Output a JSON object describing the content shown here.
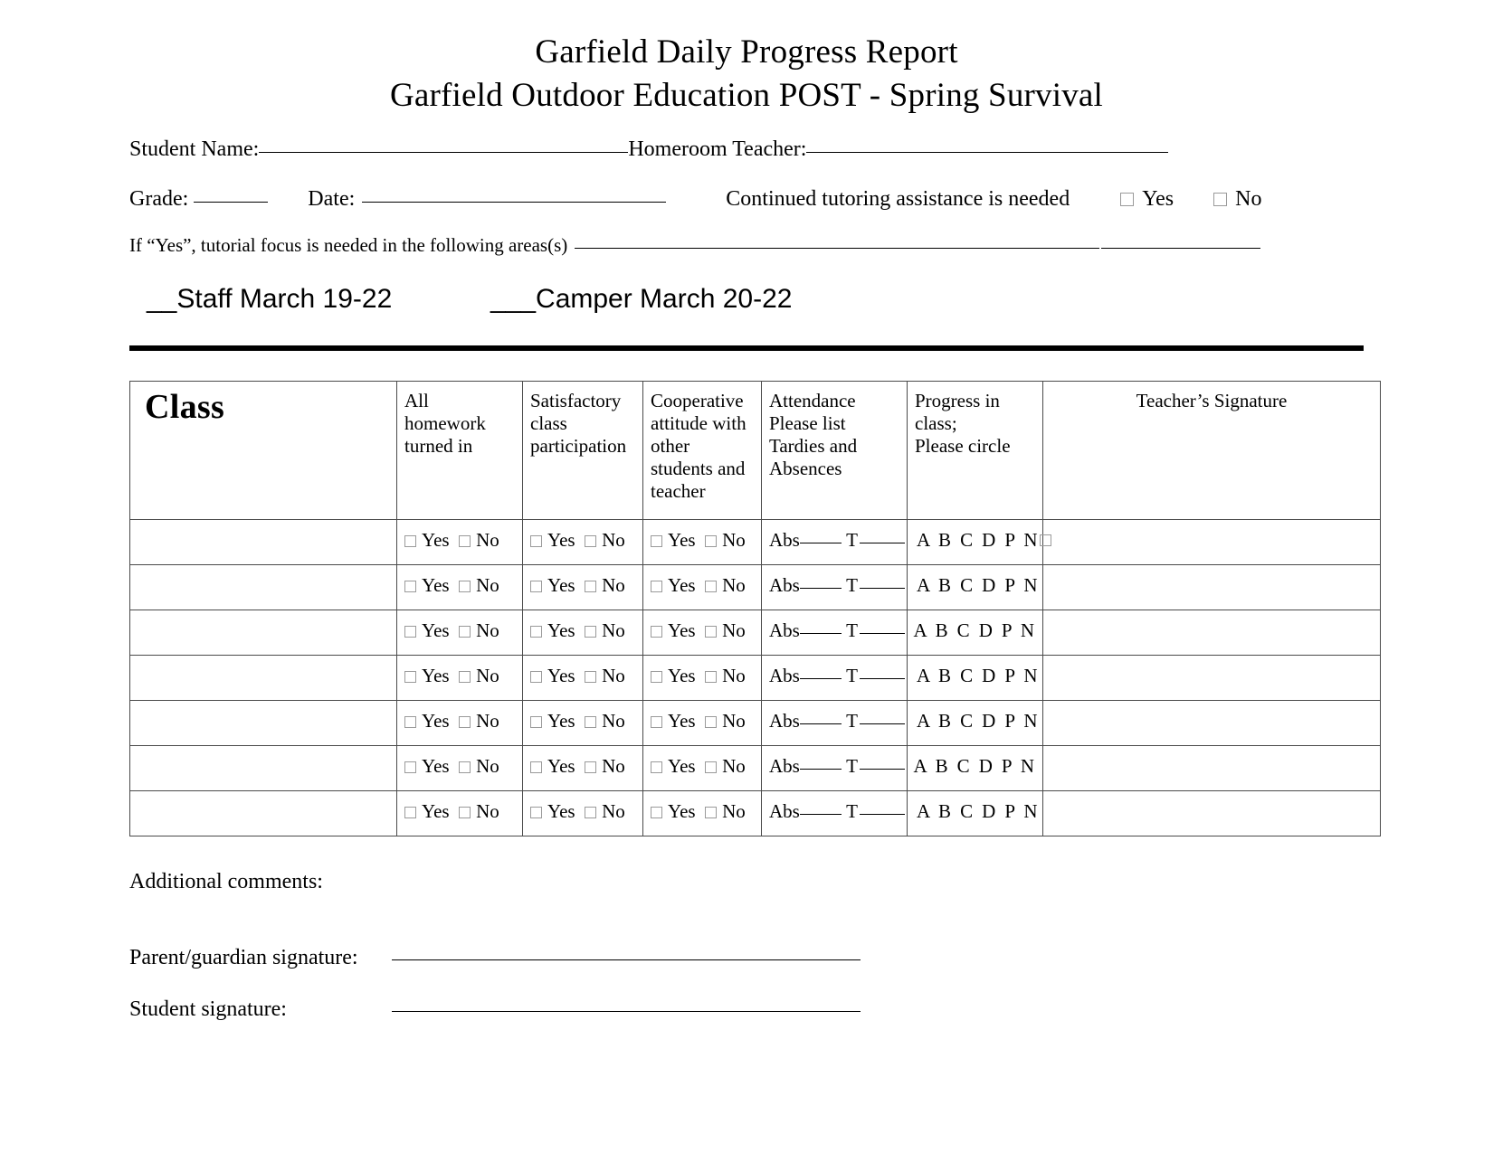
{
  "document": {
    "title_line_1": "Garfield Daily Progress Report",
    "title_line_2": "Garfield Outdoor Education POST - Spring Survival"
  },
  "header": {
    "student_name_label": "Student Name:",
    "homeroom_teacher_label": "Homeroom Teacher:",
    "grade_label": "Grade:",
    "date_label": "Date:",
    "tutoring_question": "Continued tutoring assistance is needed",
    "yes_label": "Yes",
    "no_label": "No",
    "focus_label": "If “Yes”, tutorial focus is needed in the following areas(s)"
  },
  "session_line": {
    "staff": "__Staff  March 19-22",
    "camper": "___Camper  March 20-22"
  },
  "table": {
    "columns": [
      {
        "key": "class",
        "label": "Class"
      },
      {
        "key": "homework",
        "label": "All homework turned in"
      },
      {
        "key": "participation",
        "label": "Satisfactory class participation"
      },
      {
        "key": "cooperative",
        "label": "Cooperative attitude with other students and teacher"
      },
      {
        "key": "attendance",
        "label": "Attendance Please list Tardies and Absences"
      },
      {
        "key": "progress",
        "label": "Progress in class; Please circle"
      },
      {
        "key": "signature",
        "label": "Teacher’s Signature"
      }
    ],
    "header_lines": {
      "homework": [
        "All",
        "homework",
        "turned in"
      ],
      "participation": [
        "Satisfactory",
        "class",
        "participation"
      ],
      "cooperative": [
        "Cooperative",
        "attitude with",
        "other",
        "students and",
        "teacher"
      ],
      "attendance": [
        "Attendance",
        "Please list",
        "Tardies and",
        "Absences"
      ],
      "progress": [
        "Progress in",
        "class;",
        "Please circle"
      ],
      "signature": "Teacher’s Signature"
    },
    "cell_text": {
      "yes": "Yes",
      "no": "No",
      "abs_label": "Abs",
      "tardy_label": "T",
      "grades": "A B C D P N"
    },
    "rows": [
      {
        "class": "",
        "homework": "Yes / No",
        "participation": "Yes / No",
        "cooperative": "Yes / No",
        "attendance": "Abs____ T ____",
        "progress": "A B C D P N",
        "progress_extra_box": true,
        "progress_centered": false,
        "signature": ""
      },
      {
        "class": "",
        "homework": "Yes / No",
        "participation": "Yes / No",
        "cooperative": "Yes / No",
        "attendance": "Abs____ T ____",
        "progress": "A B C D P N",
        "progress_extra_box": false,
        "progress_centered": false,
        "signature": ""
      },
      {
        "class": "",
        "homework": "Yes / No",
        "participation": "Yes / No",
        "cooperative": "Yes / No",
        "attendance": "Abs____ T ____",
        "progress": "A B C D P N",
        "progress_extra_box": false,
        "progress_centered": true,
        "signature": ""
      },
      {
        "class": "",
        "homework": "Yes / No",
        "participation": "Yes / No",
        "cooperative": "Yes / No",
        "attendance": "Abs____ T ____",
        "progress": "A B C D P N",
        "progress_extra_box": false,
        "progress_centered": false,
        "signature": ""
      },
      {
        "class": "",
        "homework": "Yes / No",
        "participation": "Yes / No",
        "cooperative": "Yes / No",
        "attendance": "Abs____ T ____",
        "progress": "A B C D P N",
        "progress_extra_box": false,
        "progress_centered": false,
        "signature": ""
      },
      {
        "class": "",
        "homework": "Yes / No",
        "participation": "Yes / No",
        "cooperative": "Yes / No",
        "attendance": "Abs____ T ____",
        "progress": "A B C D P N",
        "progress_extra_box": false,
        "progress_centered": true,
        "signature": ""
      },
      {
        "class": "",
        "homework": "Yes / No",
        "participation": "Yes / No",
        "cooperative": "Yes / No",
        "attendance": "Abs____ T ____",
        "progress": "A B C D P N",
        "progress_extra_box": false,
        "progress_centered": false,
        "signature": ""
      }
    ]
  },
  "footer": {
    "additional_comments_label": "Additional comments:",
    "parent_signature_label": "Parent/guardian signature:",
    "student_signature_label": "Student signature:"
  },
  "colors": {
    "text": "#000000",
    "background": "#ffffff",
    "table_border": "#4a4a4a",
    "checkbox_border": "#9a9a9a"
  }
}
